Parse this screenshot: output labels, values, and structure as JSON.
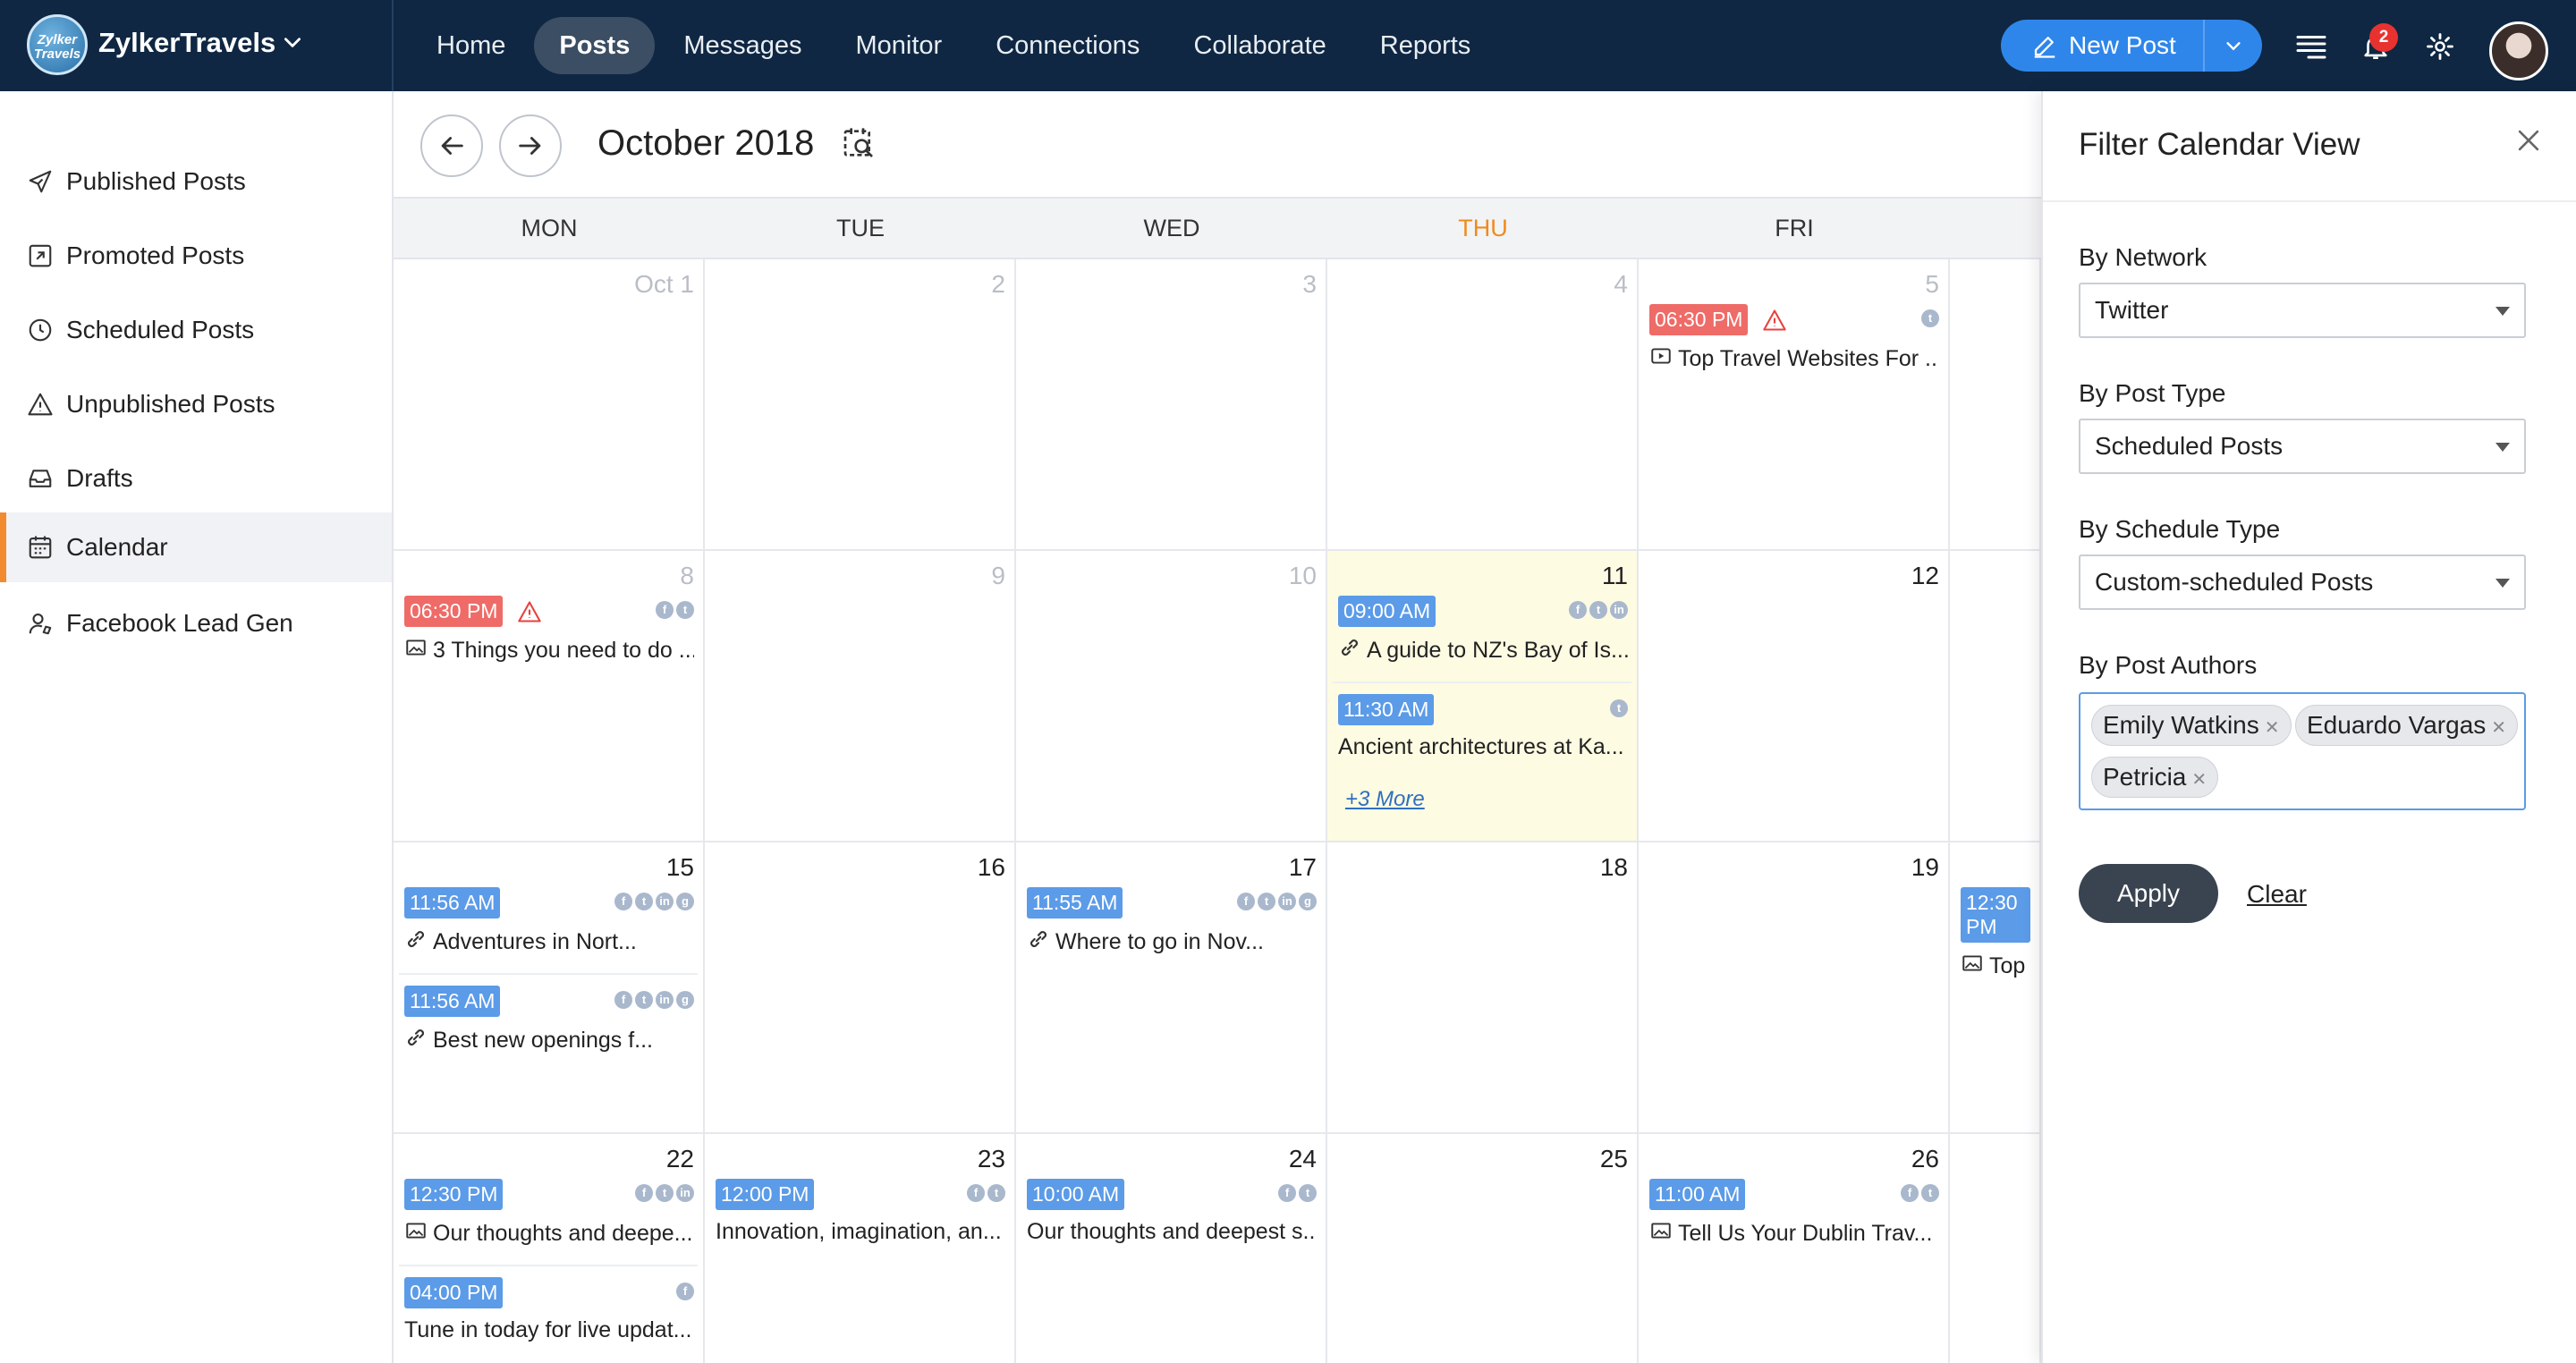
{
  "brand": {
    "name": "ZylkerTravels",
    "logo_text": "Zylker Travels"
  },
  "nav": [
    "Home",
    "Posts",
    "Messages",
    "Monitor",
    "Connections",
    "Collaborate",
    "Reports"
  ],
  "new_post_label": "New Post",
  "notifications_count": "2",
  "sidebar": {
    "items": [
      {
        "label": "Published Posts",
        "icon": "send-icon"
      },
      {
        "label": "Promoted Posts",
        "icon": "promote-icon"
      },
      {
        "label": "Scheduled Posts",
        "icon": "clock-icon"
      },
      {
        "label": "Unpublished Posts",
        "icon": "warning-icon"
      },
      {
        "label": "Drafts",
        "icon": "inbox-icon"
      },
      {
        "label": "Calendar",
        "icon": "calendar-icon"
      },
      {
        "label": "Facebook Lead Gen",
        "icon": "user-icon"
      }
    ],
    "active": "Calendar"
  },
  "calendar": {
    "month_title": "October 2018",
    "weekdays": [
      "MON",
      "TUE",
      "WED",
      "THU",
      "FRI"
    ],
    "today_weekday": "THU",
    "weeks": [
      [
        {
          "day": "Oct 1",
          "dim": true,
          "posts": []
        },
        {
          "day": "2",
          "dim": true,
          "posts": []
        },
        {
          "day": "3",
          "dim": true,
          "posts": []
        },
        {
          "day": "4",
          "dim": true,
          "posts": []
        },
        {
          "day": "5",
          "dim": true,
          "posts": [
            {
              "time": "06:30 PM",
              "red": true,
              "warn": true,
              "networks": [
                "t"
              ],
              "icon": "video",
              "title": "Top Travel Websites For ..."
            }
          ]
        }
      ],
      [
        {
          "day": "8",
          "dim": true,
          "posts": [
            {
              "time": "06:30 PM",
              "red": true,
              "warn": true,
              "networks": [
                "f",
                "t"
              ],
              "icon": "image",
              "title": "3 Things you need to do ..."
            }
          ]
        },
        {
          "day": "9",
          "dim": true,
          "posts": []
        },
        {
          "day": "10",
          "dim": true,
          "posts": []
        },
        {
          "day": "11",
          "dim": false,
          "highlight": true,
          "posts": [
            {
              "time": "09:00 AM",
              "networks": [
                "f",
                "t",
                "in"
              ],
              "icon": "link",
              "title": "A guide to NZ's Bay of Is..."
            },
            {
              "time": "11:30 AM",
              "networks": [
                "t"
              ],
              "icon": "",
              "title": "Ancient architectures at Ka..."
            }
          ],
          "more": "+3 More"
        },
        {
          "day": "12",
          "dim": false,
          "posts": []
        }
      ],
      [
        {
          "day": "15",
          "dim": false,
          "posts": [
            {
              "time": "11:56 AM",
              "networks": [
                "f",
                "t",
                "in",
                "g"
              ],
              "icon": "link",
              "title": "Adventures in Nort..."
            },
            {
              "time": "11:56 AM",
              "networks": [
                "f",
                "t",
                "in",
                "g"
              ],
              "icon": "link",
              "title": "Best new openings f..."
            }
          ]
        },
        {
          "day": "16",
          "dim": false,
          "posts": []
        },
        {
          "day": "17",
          "dim": false,
          "posts": [
            {
              "time": "11:55 AM",
              "networks": [
                "f",
                "t",
                "in",
                "g"
              ],
              "icon": "link",
              "title": "Where to go in Nov..."
            }
          ]
        },
        {
          "day": "18",
          "dim": false,
          "posts": []
        },
        {
          "day": "19",
          "dim": false,
          "posts": []
        }
      ],
      [
        {
          "day": "22",
          "dim": false,
          "posts": [
            {
              "time": "12:30 PM",
              "networks": [
                "f",
                "t",
                "in"
              ],
              "icon": "image",
              "title": "Our thoughts and deepe..."
            },
            {
              "time": "04:00 PM",
              "networks": [
                "f"
              ],
              "icon": "",
              "title": "Tune in today for live updat..."
            }
          ]
        },
        {
          "day": "23",
          "dim": false,
          "posts": [
            {
              "time": "12:00 PM",
              "networks": [
                "f",
                "t"
              ],
              "icon": "",
              "title": "Innovation, imagination, an..."
            }
          ]
        },
        {
          "day": "24",
          "dim": false,
          "posts": [
            {
              "time": "10:00 AM",
              "networks": [
                "f",
                "t"
              ],
              "icon": "",
              "title": "Our thoughts and deepest s..."
            }
          ]
        },
        {
          "day": "25",
          "dim": false,
          "posts": []
        },
        {
          "day": "26",
          "dim": false,
          "posts": [
            {
              "time": "11:00 AM",
              "networks": [
                "f",
                "t"
              ],
              "icon": "image",
              "title": "Tell Us Your Dublin Trav..."
            }
          ]
        }
      ]
    ],
    "sat_peek": {
      "time": "12:30 PM",
      "title": "Top T"
    }
  },
  "filter": {
    "title": "Filter Calendar View",
    "network_label": "By Network",
    "network_value": "Twitter",
    "post_type_label": "By Post Type",
    "post_type_value": "Scheduled Posts",
    "schedule_type_label": "By Schedule Type",
    "schedule_type_value": "Custom-scheduled Posts",
    "authors_label": "By Post Authors",
    "authors": [
      "Emily Watkins",
      "Eduardo Vargas",
      "Petricia"
    ],
    "apply_label": "Apply",
    "clear_label": "Clear"
  },
  "colors": {
    "topbar": "#0f2742",
    "accent": "#2f86ea",
    "today": "#f08a1c",
    "overdue": "#ef6b67",
    "time_chip": "#5b9be8"
  }
}
